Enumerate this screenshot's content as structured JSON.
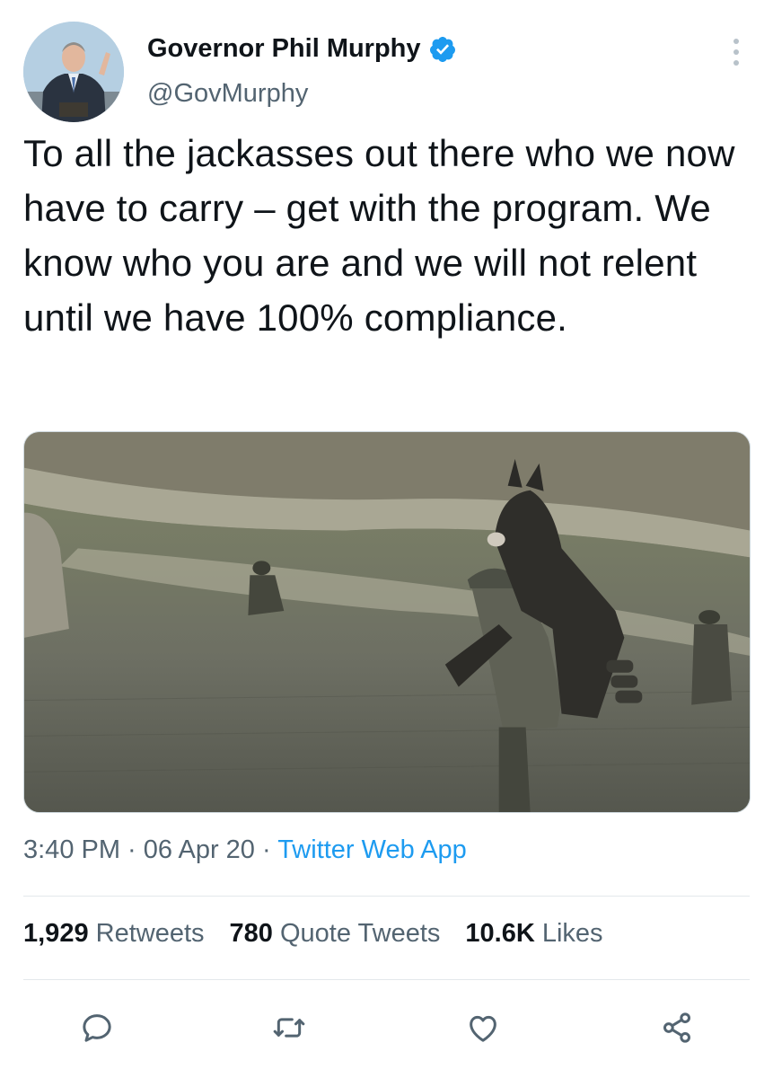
{
  "author": {
    "display_name": "Governor Phil Murphy",
    "handle": "@GovMurphy",
    "verified_icon": "verified-badge-icon"
  },
  "tweet": {
    "text": "To all the jackasses out there who we now have to carry – get with the program. We know who you are and we will not relent until we have 100% compliance."
  },
  "meta": {
    "time": "3:40 PM",
    "sep1": " · ",
    "date": "06 Apr 20",
    "sep2": " · ",
    "source": "Twitter Web App"
  },
  "stats": [
    {
      "count": "1,929",
      "label": "Retweets"
    },
    {
      "count": "780",
      "label": "Quote Tweets"
    },
    {
      "count": "10.6K",
      "label": "Likes"
    }
  ],
  "actions": [
    "reply-icon",
    "retweet-icon",
    "like-icon",
    "share-icon"
  ],
  "colors": {
    "text": "#0f1419",
    "secondary": "#536471",
    "accent": "#1d9bf0",
    "divider": "#e3e8eb"
  }
}
